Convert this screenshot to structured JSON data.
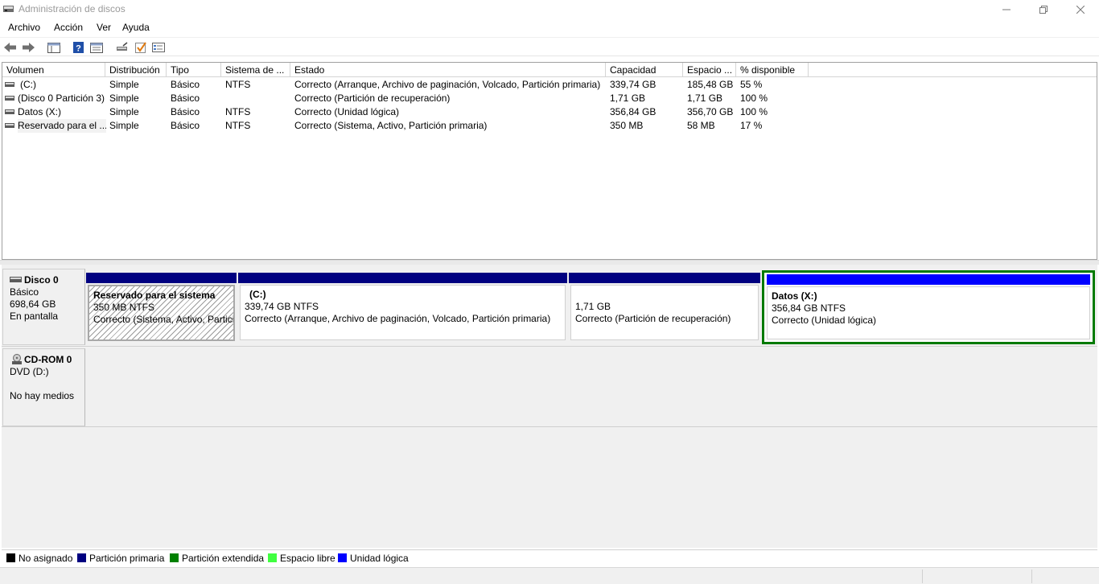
{
  "window": {
    "title": "Administración de discos",
    "minimize_icon": "minimize-icon",
    "restore_icon": "restore-icon",
    "close_icon": "close-icon"
  },
  "menu": [
    "Archivo",
    "Acción",
    "Ver",
    "Ayuda"
  ],
  "toolbar": {
    "icons": [
      "back-arrow-icon",
      "forward-arrow-icon",
      "console-view-icon",
      "help-icon",
      "properties-list-icon",
      "connect-disk-icon",
      "check-icon",
      "settings-panel-icon"
    ]
  },
  "volume_table": {
    "columns": [
      "Volumen",
      "Distribución",
      "Tipo",
      "Sistema de ...",
      "Estado",
      "Capacidad",
      "Espacio ...",
      "% disponible"
    ],
    "rows": [
      [
        "(C:)",
        "Simple",
        "Básico",
        "NTFS",
        "Correcto (Arranque, Archivo de paginación, Volcado, Partición primaria)",
        "339,74 GB",
        "185,48 GB",
        "55 %"
      ],
      [
        "(Disco 0 Partición 3)",
        "Simple",
        "Básico",
        "",
        "Correcto (Partición de recuperación)",
        "1,71 GB",
        "1,71 GB",
        "100 %"
      ],
      [
        "Datos (X:)",
        "Simple",
        "Básico",
        "NTFS",
        "Correcto (Unidad lógica)",
        "356,84 GB",
        "356,70 GB",
        "100 %"
      ],
      [
        "Reservado para el ...",
        "Simple",
        "Básico",
        "NTFS",
        "Correcto (Sistema, Activo, Partición primaria)",
        "350 MB",
        "58 MB",
        "17 %"
      ]
    ]
  },
  "disks": [
    {
      "name": "Disco 0",
      "type": "Básico",
      "size": "698,64 GB",
      "status": "En pantalla",
      "partitions": [
        {
          "title": "Reservado para el sistema",
          "size": "350 MB NTFS",
          "status": "Correcto (Sistema, Activo, Partici",
          "kind": "primary",
          "bar_color": "#000080"
        },
        {
          "title": "(C:)",
          "size": "339,74 GB NTFS",
          "status": "Correcto (Arranque, Archivo de paginación, Volcado, Partición primaria)",
          "kind": "primary",
          "bar_color": "#000080"
        },
        {
          "title": "",
          "size": "1,71 GB",
          "status": "Correcto (Partición de recuperación)",
          "kind": "primary",
          "bar_color": "#000080"
        },
        {
          "title": "Datos  (X:)",
          "size": "356,84 GB NTFS",
          "status": "Correcto (Unidad lógica)",
          "kind": "logical",
          "bar_color": "#0000ff",
          "border_color": "#007a00"
        }
      ]
    },
    {
      "name": "CD-ROM 0",
      "type": "DVD (D:)",
      "size": "",
      "status": "No hay medios"
    }
  ],
  "legend": [
    {
      "label": "No asignado",
      "color": "#000000"
    },
    {
      "label": "Partición primaria",
      "color": "#000080"
    },
    {
      "label": "Partición extendida",
      "color": "#008000"
    },
    {
      "label": "Espacio libre",
      "color": "#40ff40"
    },
    {
      "label": "Unidad lógica",
      "color": "#0000ff"
    }
  ]
}
